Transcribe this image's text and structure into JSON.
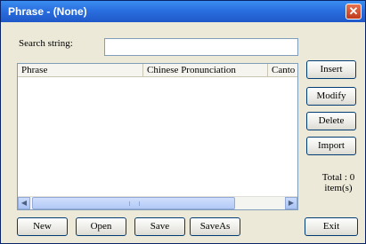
{
  "window": {
    "title": "Phrase - (None)"
  },
  "search": {
    "label": "Search string:",
    "value": ""
  },
  "list": {
    "columns": [
      "Phrase",
      "Chinese Pronunciation",
      "Canto"
    ],
    "rows": []
  },
  "side_buttons": {
    "insert": "Insert",
    "modify": "Modify",
    "delete": "Delete",
    "import": "Import"
  },
  "total": {
    "label": "Total :",
    "count": "0",
    "unit": "item(s)"
  },
  "bottom_buttons": {
    "new": "New",
    "open": "Open",
    "save": "Save",
    "saveas": "SaveAs",
    "exit": "Exit"
  },
  "icons": {
    "close": "close-icon",
    "scroll_left": "scroll-left-icon",
    "scroll_right": "scroll-right-icon"
  }
}
